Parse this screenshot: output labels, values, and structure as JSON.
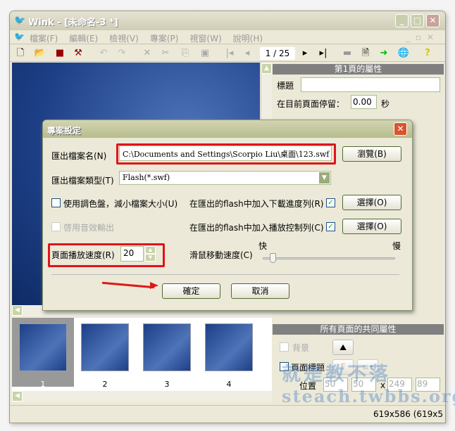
{
  "window": {
    "title": "Wink - [未命名-3 *]"
  },
  "menu": [
    "檔案(F)",
    "編輯(E)",
    "檢視(V)",
    "專案(P)",
    "視窗(W)",
    "說明(H)"
  ],
  "toolbar": {
    "page_counter": "1 / 25"
  },
  "page_props": {
    "header": "第1頁的屬性",
    "title_label": "標題",
    "title_value": "",
    "stay_label": "在目前頁面停留：",
    "stay_value": "0.00",
    "stay_unit": "秒"
  },
  "common_props": {
    "header": "所有頁面的共同屬性",
    "background_label": "背景",
    "page_title_label": "頁面標題",
    "position_label": "位置",
    "pos_x": "50",
    "pos_y": "50",
    "x_sep": "x",
    "width": "249",
    "height": "89"
  },
  "thumbnails": [
    "1",
    "2",
    "3",
    "4"
  ],
  "status": {
    "size": "619x586 (619x5"
  },
  "watermark": {
    "line1": "就是教不落",
    "line2": "steach.twbbs.org"
  },
  "dialog": {
    "title": "專案設定",
    "export_name_label": "匯出檔案名(N)",
    "export_name_value": "C:\\Documents and Settings\\Scorpio Liu\\桌面\\123.swf",
    "browse": "瀏覽(B)",
    "export_type_label": "匯出檔案類型(T)",
    "export_type_value": "Flash(*.swf)",
    "palette_label": "使用調色盤，減小檔案大小(U)",
    "sound_label": "啓用音效輸出",
    "progress_label": "在匯出的flash中加入下載進度列(R)",
    "control_label": "在匯出的flash中加入播放控制列(C)",
    "choose": "選擇(O)",
    "speed_label": "頁面播放速度(R)",
    "speed_value": "20",
    "mouse_label": "滑鼠移動速度(C)",
    "fast": "快",
    "slow": "慢",
    "mouse_speed_fraction": 0.05,
    "ok": "確定",
    "cancel": "取消"
  }
}
